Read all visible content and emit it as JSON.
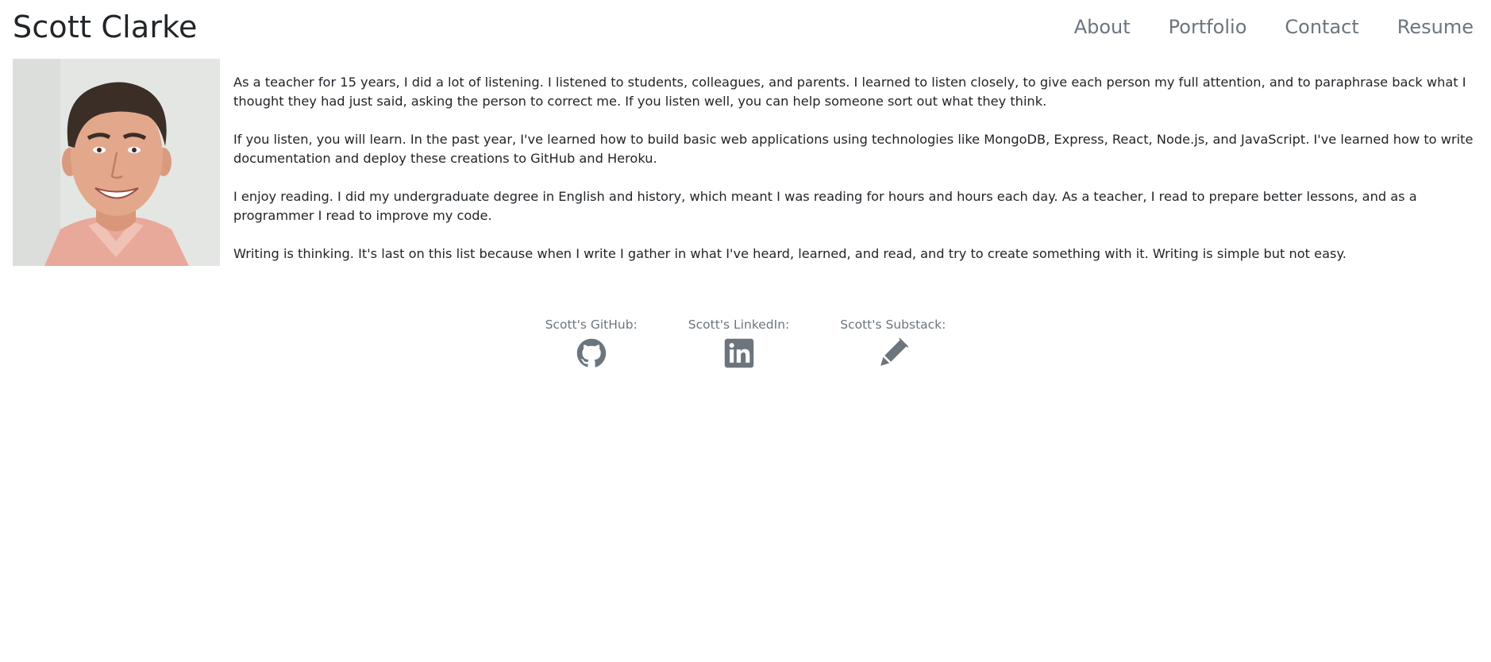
{
  "header": {
    "brand": "Scott Clarke",
    "nav": [
      {
        "label": "About"
      },
      {
        "label": "Portfolio"
      },
      {
        "label": "Contact"
      },
      {
        "label": "Resume"
      }
    ]
  },
  "about": {
    "photo_icon": "profile-photo",
    "paragraphs": [
      "As a teacher for 15 years, I did a lot of listening. I listened to students, colleagues, and parents. I learned to listen closely, to give each person my full attention, and to paraphrase back what I thought they had just said, asking the person to correct me. If you listen well, you can help someone sort out what they think.",
      "If you listen, you will learn. In the past year, I've learned how to build basic web applications using technologies like MongoDB, Express, React, Node.js, and JavaScript. I've learned how to write documentation and deploy these creations to GitHub and Heroku.",
      "I enjoy reading. I did my undergraduate degree in English and history, which meant I was reading for hours and hours each day. As a teacher, I read to prepare better lessons, and as a programmer I read to improve my code.",
      "Writing is thinking. It's last on this list because when I write I gather in what I've heard, learned, and read, and try to create something with it. Writing is simple but not easy."
    ]
  },
  "links": [
    {
      "label": "Scott's GitHub:",
      "icon": "github-icon"
    },
    {
      "label": "Scott's LinkedIn:",
      "icon": "linkedin-icon"
    },
    {
      "label": "Scott's Substack:",
      "icon": "pen-icon"
    }
  ],
  "colors": {
    "text": "#212529",
    "muted": "#6c757d",
    "background": "#ffffff"
  }
}
